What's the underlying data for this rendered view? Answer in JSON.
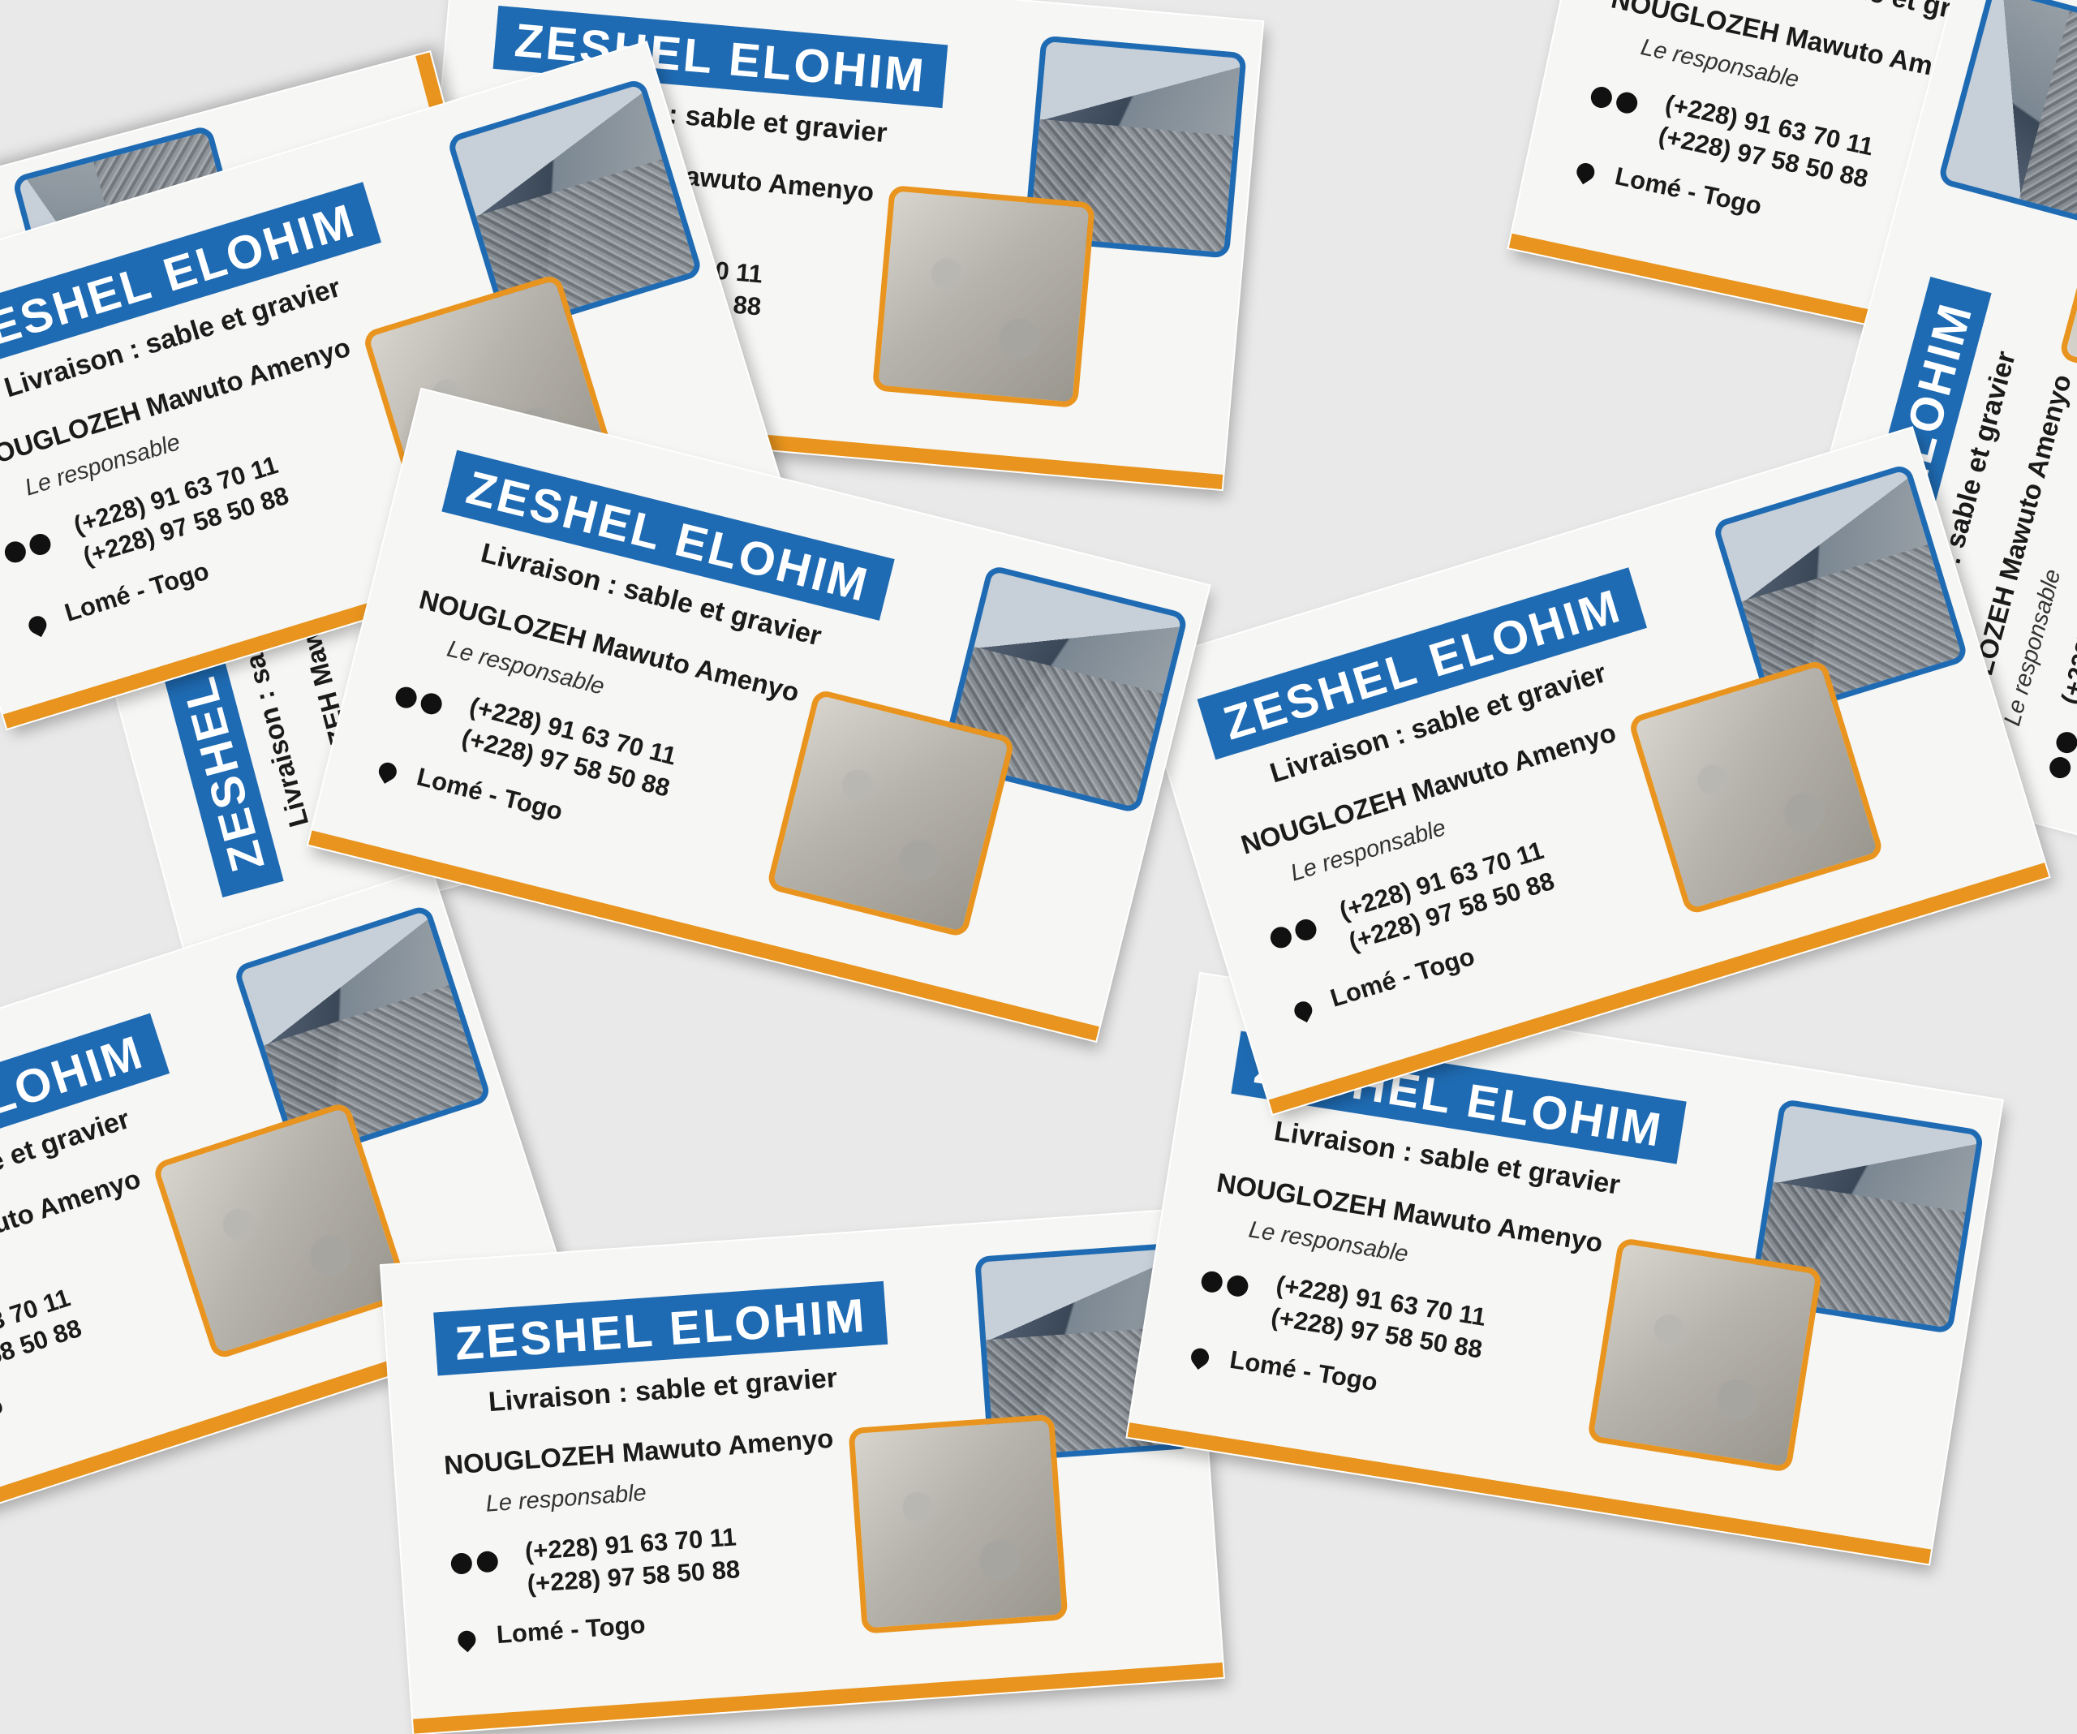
{
  "card": {
    "company": "ZESHEL ELOHIM",
    "tagline": "Livraison : sable et gravier",
    "name": "NOUGLOZEH Mawuto Amenyo",
    "role": "Le responsable",
    "phone_1": "(+228) 91 63 70 11",
    "phone_2": "(+228) 97 58 50 88",
    "location": "Lomé - Togo",
    "icons": [
      "phone-icon",
      "whatsapp-icon",
      "location-pin-icon"
    ],
    "colors": {
      "accent_blue": "#1f6bb3",
      "accent_orange": "#e8941e",
      "card_bg": "#f6f6f4"
    }
  }
}
